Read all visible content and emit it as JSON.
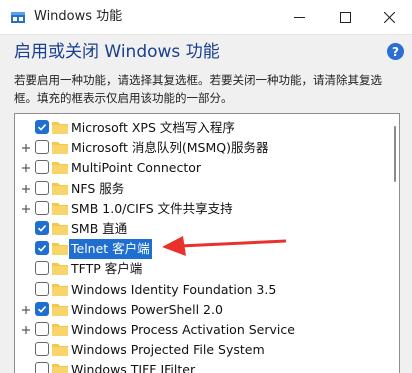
{
  "window": {
    "title": "Windows 功能",
    "heading": "启用或关闭 Windows 功能",
    "description": "若要启用一种功能，请选择其复选框。若要关闭一种功能，请清除其复选框。填充的框表示仅启用该功能的一部分。",
    "help_label": "?",
    "icons": [
      "windows-features-icon",
      "minimize-icon",
      "maximize-icon",
      "close-icon",
      "help-icon"
    ]
  },
  "features": [
    {
      "label": "Microsoft XPS 文档写入程序",
      "checked": true,
      "expandable": false
    },
    {
      "label": "Microsoft 消息队列(MSMQ)服务器",
      "checked": false,
      "expandable": true
    },
    {
      "label": "MultiPoint Connector",
      "checked": false,
      "expandable": true
    },
    {
      "label": "NFS 服务",
      "checked": false,
      "expandable": true
    },
    {
      "label": "SMB 1.0/CIFS 文件共享支持",
      "checked": false,
      "expandable": true
    },
    {
      "label": "SMB 直通",
      "checked": true,
      "expandable": false
    },
    {
      "label": "Telnet 客户端",
      "checked": true,
      "expandable": false,
      "selected": true
    },
    {
      "label": "TFTP 客户端",
      "checked": false,
      "expandable": false
    },
    {
      "label": "Windows Identity Foundation 3.5",
      "checked": false,
      "expandable": false
    },
    {
      "label": "Windows PowerShell 2.0",
      "checked": true,
      "expandable": true
    },
    {
      "label": "Windows Process Activation Service",
      "checked": false,
      "expandable": true
    },
    {
      "label": "Windows Projected File System",
      "checked": false,
      "expandable": false
    },
    {
      "label": "Windows TIFF IFilter",
      "checked": false,
      "expandable": false
    }
  ],
  "colors": {
    "accent": "#1f6fd1",
    "arrow": "#e8322b",
    "heading": "#1a3f8f",
    "folder": "#f2c94c"
  }
}
